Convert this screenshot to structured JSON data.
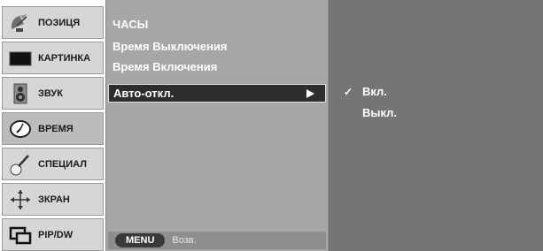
{
  "sidebar": {
    "items": [
      {
        "label": "ПОЗИЦЯ",
        "icon": "satellite-dish-icon"
      },
      {
        "label": "КАРТИНКА",
        "icon": "screen-icon"
      },
      {
        "label": "ЗВУК",
        "icon": "speaker-icon"
      },
      {
        "label": "ВРЕМЯ",
        "icon": "clock-icon",
        "active": true
      },
      {
        "label": "СПЕЦИАЛ",
        "icon": "special-icon"
      },
      {
        "label": "ЗКРАН",
        "icon": "screen-adjust-icon"
      },
      {
        "label": "PIP/DW",
        "icon": "pip-icon"
      }
    ]
  },
  "menu": {
    "items": [
      "ЧАСЫ",
      "Время Выключения",
      "Время Включения"
    ],
    "selected": "Авто-откл."
  },
  "footer": {
    "button_label": "MENU",
    "text": "Возв."
  },
  "submenu": {
    "options": [
      {
        "label": "Вкл.",
        "checked": true,
        "check_mark": "✓"
      },
      {
        "label": "Выкл.",
        "checked": false
      }
    ]
  },
  "colors": {
    "sidebar_bg": "#d6d6d6",
    "menu_bg": "#a6a6a6",
    "submenu_bg": "#757575",
    "selected_bg": "#2e2e2e"
  }
}
